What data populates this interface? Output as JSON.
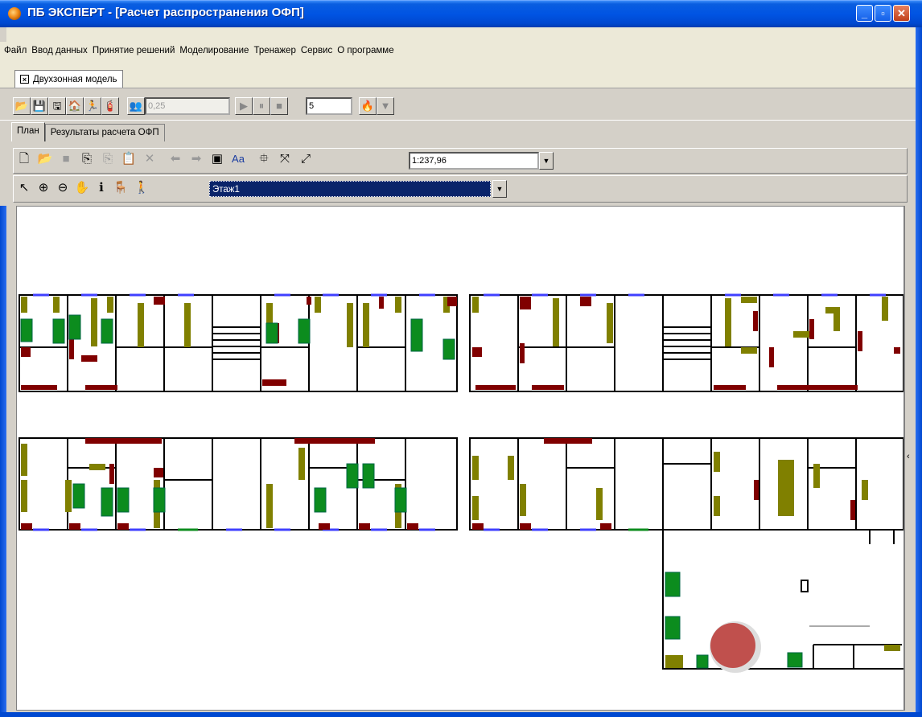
{
  "window": {
    "title": "ПБ ЭКСПЕРТ - [Расчет распространения ОФП]",
    "controls": [
      "minimize",
      "restore",
      "close"
    ]
  },
  "menu": {
    "items": [
      "Файл",
      "Ввод данных",
      "Принятие решений",
      "Моделирование",
      "Тренажер",
      "Сервис",
      "О программе"
    ]
  },
  "document_tab": {
    "label": "Двухзонная модель",
    "close_glyph": "×"
  },
  "sim_toolbar": {
    "time_step": "0,25",
    "speed": "5"
  },
  "plan_tabs": [
    "План",
    "Результаты расчета ОФП"
  ],
  "edit_toolbar": {
    "scale": "1:237,96"
  },
  "view_toolbar": {
    "floor": "Этаж1"
  },
  "colors": {
    "title_bar": "#0054e3",
    "furniture": "#808000",
    "fire_item": "#800000",
    "person_green": "#0c8c1e",
    "door_blue": "#4040ff",
    "marker_red": "#c0504d"
  }
}
